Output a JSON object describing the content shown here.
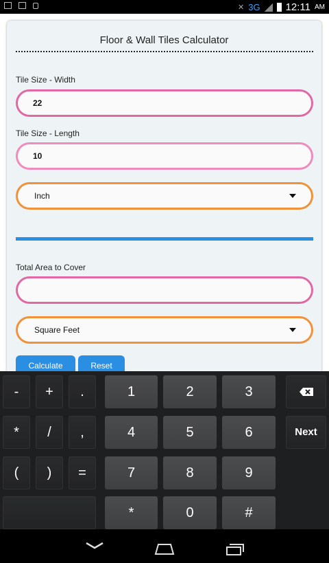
{
  "status": {
    "network": "3G",
    "time": "12:11",
    "ampm": "AM"
  },
  "app": {
    "title": "Floor & Wall Tiles Calculator",
    "width_label": "Tile Size - Width",
    "width_value": "22",
    "length_label": "Tile Size - Length",
    "length_value": "10",
    "unit_select": "Inch",
    "area_label": "Total Area to Cover",
    "area_value": "",
    "area_unit_select": "Square Feet",
    "calculate_label": "Calculate",
    "reset_label": "Reset"
  },
  "keyboard": {
    "row1": [
      "-",
      "+",
      ".",
      "1",
      "2",
      "3"
    ],
    "row2": [
      "*",
      "/",
      ",",
      "4",
      "5",
      "6"
    ],
    "row3": [
      "(",
      ")",
      "=",
      "7",
      "8",
      "9"
    ],
    "row4": [
      "*",
      "0",
      "#"
    ],
    "next_label": "Next"
  }
}
